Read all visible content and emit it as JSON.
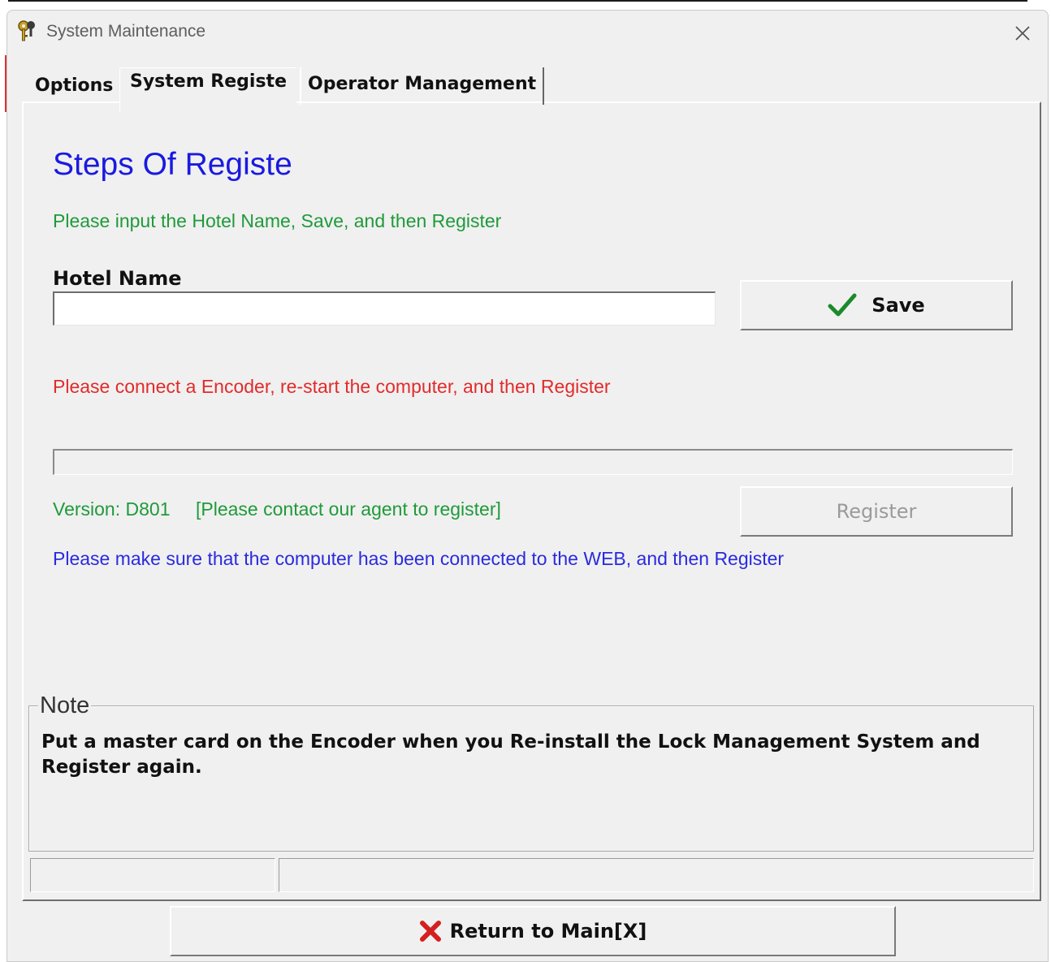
{
  "window": {
    "title": "System Maintenance",
    "icon": "keys-icon",
    "close_icon": "close-icon"
  },
  "tabs": [
    {
      "label": "Options",
      "active": false
    },
    {
      "label": "System Registe",
      "active": true
    },
    {
      "label": "Operator Management",
      "active": false
    }
  ],
  "registe": {
    "heading": "Steps Of Registe",
    "instruction": "Please input the Hotel Name, Save, and then Register",
    "hotel_label": "Hotel Name",
    "hotel_value": "",
    "save_label": "Save",
    "save_icon": "checkmark-icon",
    "encoder_warning": "Please connect a Encoder, re-start the computer, and then Register",
    "progress_percent": 0,
    "version_text": "Version: D801",
    "contact_text": "[Please contact our agent to register]",
    "register_label": "Register",
    "register_enabled": false,
    "web_note": "Please make sure that the computer has been connected to the WEB, and then Register"
  },
  "note": {
    "legend": "Note",
    "text": "Put a master card on the Encoder when you Re-install the Lock Management System and Register again."
  },
  "status_bar": [
    "",
    ""
  ],
  "footer": {
    "return_label": "Return to Main[X]",
    "return_icon": "red-x-icon"
  },
  "colors": {
    "heading_blue": "#1a1ae0",
    "green": "#1f9a3a",
    "red": "#e22b2b",
    "blue": "#2a2ae0",
    "window_bg": "#f0f0f0"
  }
}
